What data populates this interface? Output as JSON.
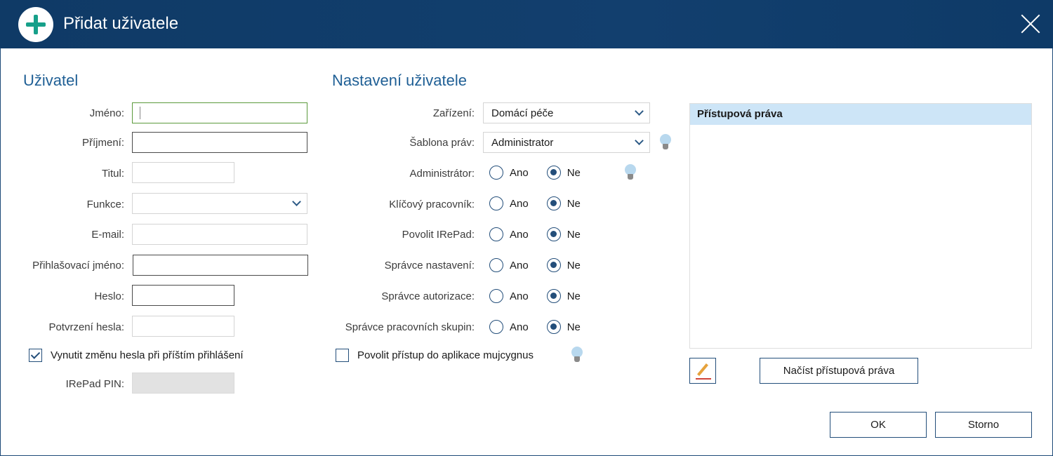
{
  "dialog": {
    "title": "Přidat uživatele"
  },
  "user_section": {
    "heading": "Uživatel",
    "fields": {
      "jmeno": "Jméno:",
      "prijmeni": "Příjmení:",
      "titul": "Titul:",
      "funkce": "Funkce:",
      "email": "E-mail:",
      "login": "Přihlašovací jméno:",
      "heslo": "Heslo:",
      "potvrzeni": "Potvrzení hesla:",
      "pin": "IRePad PIN:"
    },
    "force_change_label": "Vynutit změnu hesla při příštím přihlášení",
    "force_change_checked": true
  },
  "settings_section": {
    "heading": "Nastavení uživatele",
    "zarizeni_label": "Zařízení:",
    "zarizeni_value": "Domácí péče",
    "sablona_label": "Šablona práv:",
    "sablona_value": "Administrator",
    "radio_yes": "Ano",
    "radio_no": "Ne",
    "options": [
      {
        "label": "Administrátor:",
        "selected": "Ne"
      },
      {
        "label": "Klíčový pracovník:",
        "selected": "Ne"
      },
      {
        "label": "Povolit IRePad:",
        "selected": "Ne"
      },
      {
        "label": "Správce nastavení:",
        "selected": "Ne"
      },
      {
        "label": "Správce autorizace:",
        "selected": "Ne"
      },
      {
        "label": "Správce pracovních skupin:",
        "selected": "Ne"
      }
    ],
    "mujcygnus_label": "Povolit přístup do aplikace mujcygnus",
    "mujcygnus_checked": false
  },
  "rights": {
    "header": "Přístupová práva",
    "load_button": "Načíst přístupová práva"
  },
  "footer": {
    "ok": "OK",
    "cancel": "Storno"
  },
  "colors": {
    "titlebar": "#123f6e",
    "accent": "#234e7a",
    "heading": "#1f5f95",
    "rights_header": "#cde5f7"
  }
}
